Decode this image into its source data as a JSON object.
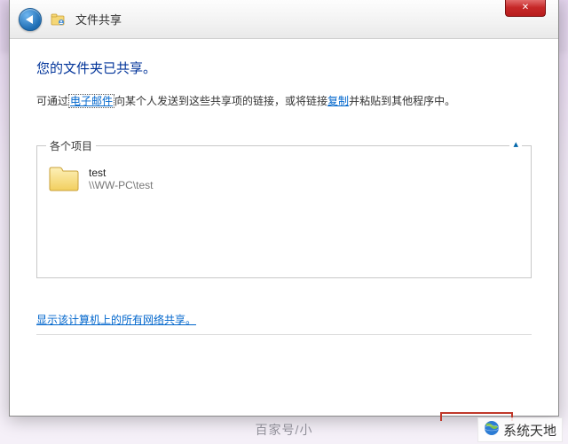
{
  "titlebar": {
    "close_glyph": "✕"
  },
  "header": {
    "title": "文件共享"
  },
  "content": {
    "heading": "您的文件夹已共享。",
    "instruction_pre": "可通过",
    "email_link": "电子邮件",
    "instruction_mid": "向某个人发送到这些共享项的链接，或将链接",
    "copy_link": "复制",
    "instruction_post": "并粘贴到其他程序中。"
  },
  "group": {
    "legend": "各个项目",
    "collapse_glyph": "▴",
    "items": [
      {
        "name": "test",
        "path": "\\\\WW-PC\\test"
      }
    ]
  },
  "bottom_link": "显示该计算机上的所有网络共享。",
  "watermark": {
    "left": "百家号/小",
    "right": "系统天地"
  }
}
